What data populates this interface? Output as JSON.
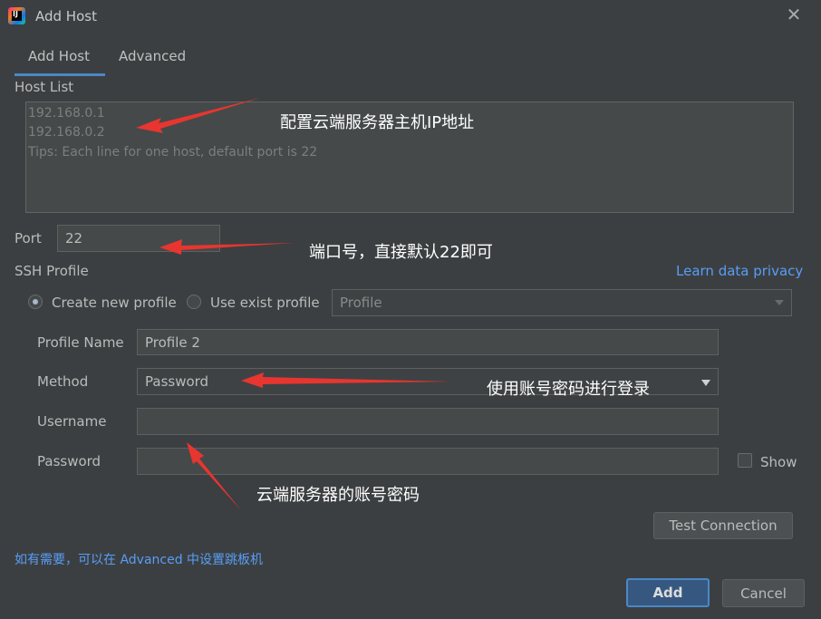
{
  "window": {
    "title": "Add Host",
    "app_icon_letter": "IJ",
    "close_glyph": "✕"
  },
  "tabs": [
    {
      "label": "Add Host",
      "active": true
    },
    {
      "label": "Advanced",
      "active": false
    }
  ],
  "host_list": {
    "label": "Host List",
    "lines": [
      "192.168.0.1",
      "192.168.0.2",
      "Tips: Each line for one host, default port is 22"
    ]
  },
  "port": {
    "label": "Port",
    "value": "22"
  },
  "ssh_profile": {
    "label": "SSH Profile",
    "privacy_link": "Learn data privacy",
    "option_new": "Create new profile",
    "option_exist": "Use exist profile",
    "selected_option": "Create new profile",
    "profile_select": "Profile"
  },
  "form": {
    "profile_name_label": "Profile Name",
    "profile_name_value": "Profile 2",
    "method_label": "Method",
    "method_value": "Password",
    "username_label": "Username",
    "username_value": "",
    "password_label": "Password",
    "password_value": "",
    "show_label": "Show",
    "show_checked": false
  },
  "test_connection": "Test Connection",
  "hint": "如有需要，可以在 Advanced 中设置跳板机",
  "buttons": {
    "add": "Add",
    "cancel": "Cancel"
  },
  "annotations": {
    "host": "配置云端服务器主机IP地址",
    "port": "端口号，直接默认22即可",
    "method": "使用账号密码进行登录",
    "password": "云端服务器的账号密码"
  },
  "colors": {
    "background": "#3c3f41",
    "accent": "#4a88c7",
    "link": "#589df6",
    "arrow": "#e8352f"
  }
}
